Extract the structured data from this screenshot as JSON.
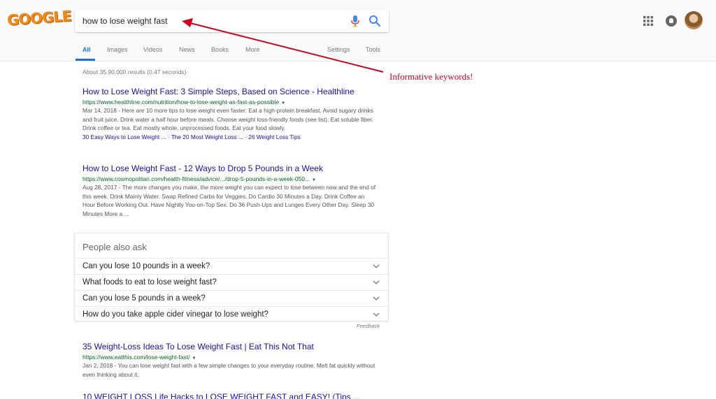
{
  "header": {
    "logo_text": "GOOGLE",
    "search_query": "how to lose weight fast"
  },
  "tabs": [
    {
      "label": "All",
      "active": true
    },
    {
      "label": "Images"
    },
    {
      "label": "Videos"
    },
    {
      "label": "News"
    },
    {
      "label": "Books"
    },
    {
      "label": "More"
    },
    {
      "label": "Settings"
    },
    {
      "label": "Tools"
    }
  ],
  "stats": "About 35,90,000 results (0.47 seconds)",
  "results": [
    {
      "title": "How to Lose Weight Fast: 3 Simple Steps, Based on Science - Healthline",
      "url": "https://www.healthline.com/nutrition/how-to-lose-weight-as-fast-as-possible",
      "snippet": "Mar 14, 2018 - Here are 10 more tips to lose weight even faster: Eat a high-protein breakfast. Avoid sugary drinks and fruit juice. Drink water a half hour before meals. Choose weight loss-friendly foods (see list). Eat soluble fiber. Drink coffee or tea. Eat mostly whole, unprocessed foods. Eat your food slowly.",
      "sitelinks": [
        "30 Easy Ways to Lose Weight ...",
        "The 20 Most Weight Loss ...",
        "26 Weight Loss Tips"
      ]
    },
    {
      "title": "How to Lose Weight Fast - 12 Ways to Drop 5 Pounds in a Week",
      "url": "https://www.cosmopolitan.com/health-fitness/advice/.../drop-5-pounds-in-a-week-050...",
      "snippet": "Aug 28, 2017 - The more changes you make, the more weight you can expect to lose between now and the end of this week. Drink Mainly Water. Swap Refined Carbs for Veggies. Do Cardio 30 Minutes a Day. Drink Coffee an Hour Before Working Out. Have Nightly You-on-Top Sex. Do 36 Push-Ups and Lunges Every Other Day. Sleep 30 Minutes More a ..."
    },
    {
      "title": "35 Weight-Loss Ideas To Lose Weight Fast | Eat This Not That",
      "url": "https://www.eatthis.com/lose-weight-fast/",
      "snippet": "Jan 2, 2018 - You can lose weight fast with a few simple changes to your everyday routine. Melt fat quickly without even thinking about it."
    },
    {
      "title": "10 WEIGHT LOSS Life Hacks to LOSE WEIGHT FAST and EASY! (Tips ..."
    }
  ],
  "people_also_ask": {
    "title": "People also ask",
    "questions": [
      "Can you lose 10 pounds in a week?",
      "What foods to eat to lose weight fast?",
      "Can you lose 5 pounds in a week?",
      "How do you take apple cider vinegar to lose weight?"
    ],
    "feedback": "Feedback"
  },
  "annotation": {
    "text": "Informative keywords!",
    "color": "#d0021b"
  },
  "colors": {
    "link": "#1a0dab",
    "url": "#006621",
    "accent": "#1a73e8"
  }
}
